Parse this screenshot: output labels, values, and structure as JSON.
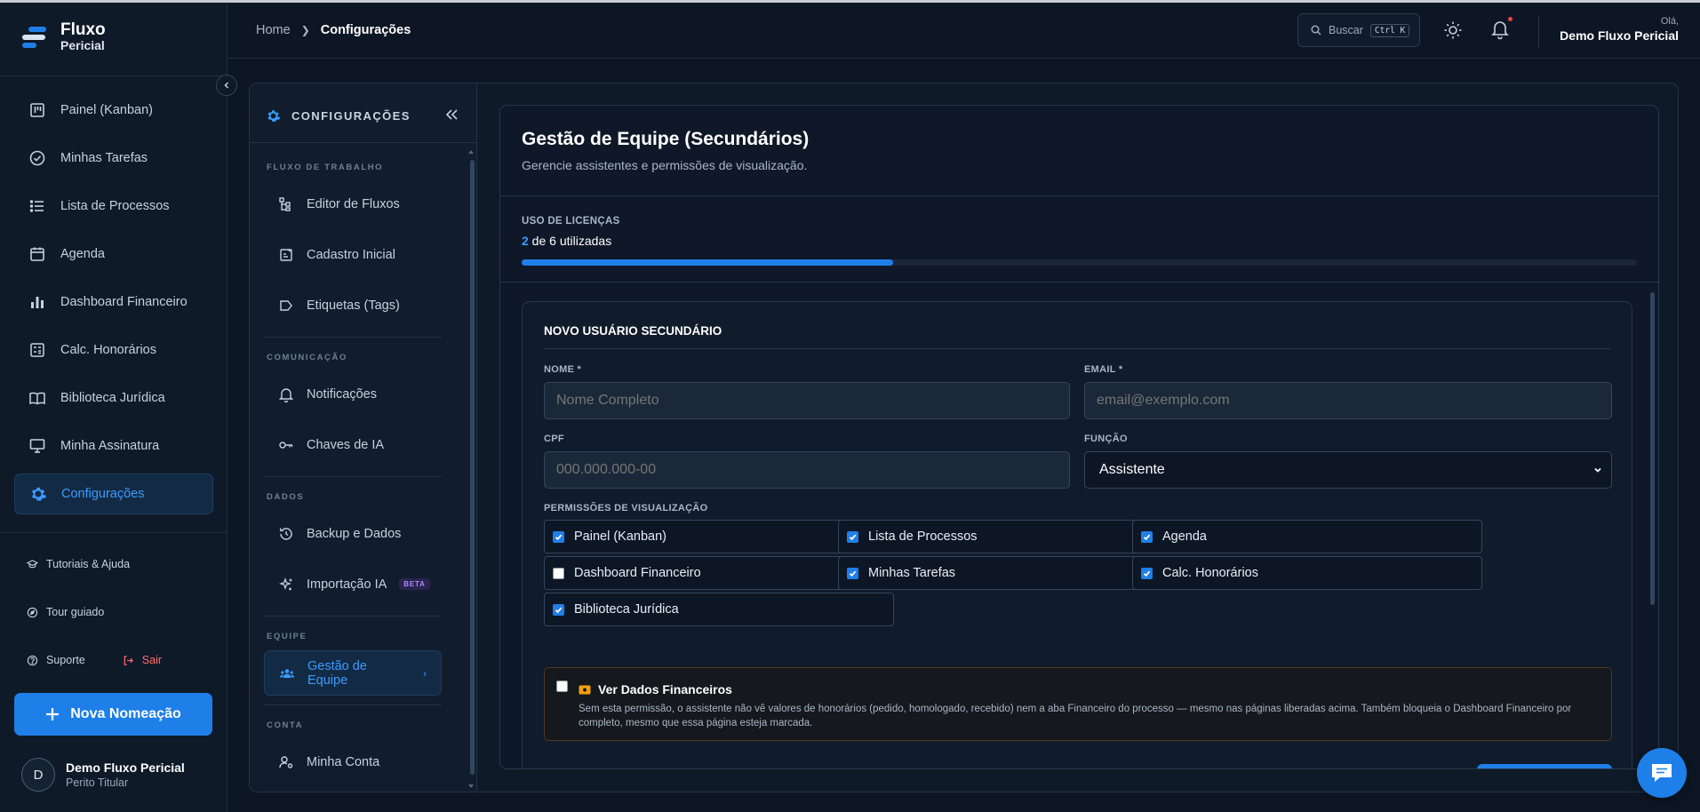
{
  "brand": {
    "name": "Fluxo",
    "sub": "Pericial"
  },
  "nav": [
    {
      "label": "Painel (Kanban)",
      "icon": "kanban-icon"
    },
    {
      "label": "Minhas Tarefas",
      "icon": "check-circle-icon"
    },
    {
      "label": "Lista de Processos",
      "icon": "list-icon"
    },
    {
      "label": "Agenda",
      "icon": "calendar-icon"
    },
    {
      "label": "Dashboard Financeiro",
      "icon": "bar-chart-icon"
    },
    {
      "label": "Calc. Honorários",
      "icon": "calculator-icon"
    },
    {
      "label": "Biblioteca Jurídica",
      "icon": "book-icon"
    },
    {
      "label": "Minha Assinatura",
      "icon": "monitor-icon"
    },
    {
      "label": "Configurações",
      "icon": "gear-icon",
      "active": true
    }
  ],
  "help": {
    "tutorials": "Tutoriais & Ajuda",
    "tour": "Tour guiado",
    "support": "Suporte",
    "logout": "Sair"
  },
  "new_button": "Nova Nomeação",
  "user": {
    "initial": "D",
    "name": "Demo Fluxo Pericial",
    "role": "Perito Titular"
  },
  "header": {
    "breadcrumb_home": "Home",
    "breadcrumb_current": "Configurações",
    "search_label": "Buscar",
    "search_shortcut": "Ctrl K",
    "greeting": "Olá,",
    "greeting_name": "Demo Fluxo Pericial"
  },
  "settings_nav": {
    "title": "CONFIGURAÇÕES",
    "groups": [
      {
        "label": "FLUXO DE TRABALHO",
        "items": [
          "Editor de Fluxos",
          "Cadastro Inicial",
          "Etiquetas (Tags)"
        ]
      },
      {
        "label": "COMUNICAÇÃO",
        "items": [
          "Notificações",
          "Chaves de IA"
        ]
      },
      {
        "label": "DADOS",
        "items": [
          "Backup e Dados",
          "Importação IA"
        ]
      },
      {
        "label": "EQUIPE",
        "items": [
          "Gestão de Equipe"
        ]
      },
      {
        "label": "CONTA",
        "items": [
          "Minha Conta"
        ]
      }
    ],
    "beta_badge": "BETA"
  },
  "team": {
    "title": "Gestão de Equipe (Secundários)",
    "subtitle": "Gerencie assistentes e permissões de visualização.",
    "license_label": "USO DE LICENÇAS",
    "license_used": "2",
    "license_rest": " de 6 utilizadas",
    "license_fraction": 0.333
  },
  "form": {
    "title": "NOVO USUÁRIO SECUNDÁRIO",
    "name_label": "NOME *",
    "name_placeholder": "Nome Completo",
    "email_label": "EMAIL *",
    "email_placeholder": "email@exemplo.com",
    "cpf_label": "CPF",
    "cpf_placeholder": "000.000.000-00",
    "role_label": "FUNÇÃO",
    "role_value": "Assistente",
    "perms_label": "PERMISSÕES DE VISUALIZAÇÃO",
    "permissions": [
      {
        "label": "Painel (Kanban)",
        "checked": true
      },
      {
        "label": "Lista de Processos",
        "checked": true
      },
      {
        "label": "Agenda",
        "checked": true
      },
      {
        "label": "Dashboard Financeiro",
        "checked": false
      },
      {
        "label": "Minhas Tarefas",
        "checked": true
      },
      {
        "label": "Calc. Honorários",
        "checked": true
      },
      {
        "label": "Biblioteca Jurídica",
        "checked": true
      }
    ],
    "financial_title": "Ver Dados Financeiros",
    "financial_checked": false,
    "financial_text": "Sem esta permissão, o assistente não vê valores de honorários (pedido, homologado, recebido) nem a aba Financeiro do processo — mesmo nas páginas liberadas acima. Também bloqueia o Dashboard Financeiro por completo, mesmo que essa página esteja marcada."
  },
  "colors": {
    "accent": "#1f7fe8",
    "bg": "#0d1624",
    "danger": "#ff6b6b",
    "beta": "#a78bfa"
  }
}
